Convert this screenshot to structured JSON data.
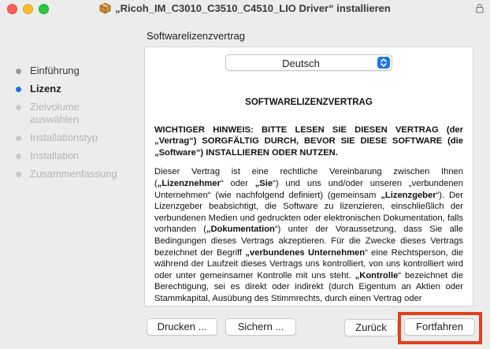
{
  "window": {
    "title": "„Ricoh_IM_C3010_C3510_C4510_LIO Driver“ installieren"
  },
  "section_title": "Softwarelizenzvertrag",
  "steps": [
    {
      "label": "Einführung",
      "state": "done"
    },
    {
      "label": "Lizenz",
      "state": "active"
    },
    {
      "label": "Zielvolume auswählen",
      "state": "disabled"
    },
    {
      "label": "Installationstyp",
      "state": "disabled"
    },
    {
      "label": "Installation",
      "state": "disabled"
    },
    {
      "label": "Zusammenfassung",
      "state": "disabled"
    }
  ],
  "language_select": {
    "value": "Deutsch"
  },
  "license": {
    "heading": "SOFTWARELIZENZVERTRAG",
    "notice": "WICHTIGER HINWEIS: BITTE LESEN SIE DIESEN VERTRAG (der „Vertrag“) SORGFÄLTIG DURCH, BEVOR SIE DIESE SOFTWARE (die „Software“) INSTALLIEREN ODER NUTZEN.",
    "p1_a": "Dieser Vertrag ist eine rechtliche Vereinbarung zwischen Ihnen (",
    "p1_b1": "„Lizenznehmer",
    "p1_c": "“ oder ",
    "p1_b2": "„Sie",
    "p1_d": "“) und uns und/oder unseren „verbundenen Unternehmen“ (wie nachfolgend definiert) (gemeinsam ",
    "p1_b3": "„Lizenzgeber",
    "p1_e": "“). Der Lizenzgeber beabsichtigt, die Software zu lizenzieren, einschließlich der verbundenen Medien und gedruckten oder elektronischen Dokumentation, falls vorhanden (",
    "p1_b4": "„Dokumentation",
    "p1_f": "“) unter der Voraussetzung, dass Sie alle Bedingungen dieses Vertrags akzeptieren. Für die Zwecke dieses Vertrags bezeichnet der Begriff ",
    "p1_b5": "„verbundenes Unternehmen",
    "p1_g": "“ eine Rechtsperson, die während der Laufzeit dieses Vertrags uns kontrolliert, von uns kontrolliert wird oder unter gemeinsamer Kontrolle mit uns steht. ",
    "p1_b6": "„Kontrolle",
    "p1_h": "“ bezeichnet die Berechtigung, sei es direkt oder indirekt (durch Eigentum an Aktien oder Stammkapital, Ausübung des Stimmrechts, durch einen Vertrag oder"
  },
  "buttons": {
    "print": "Drucken ...",
    "save": "Sichern ...",
    "back": "Zurück",
    "continue": "Fortfahren"
  },
  "colors": {
    "accent": "#1a74e8",
    "highlight": "#e0401a"
  }
}
